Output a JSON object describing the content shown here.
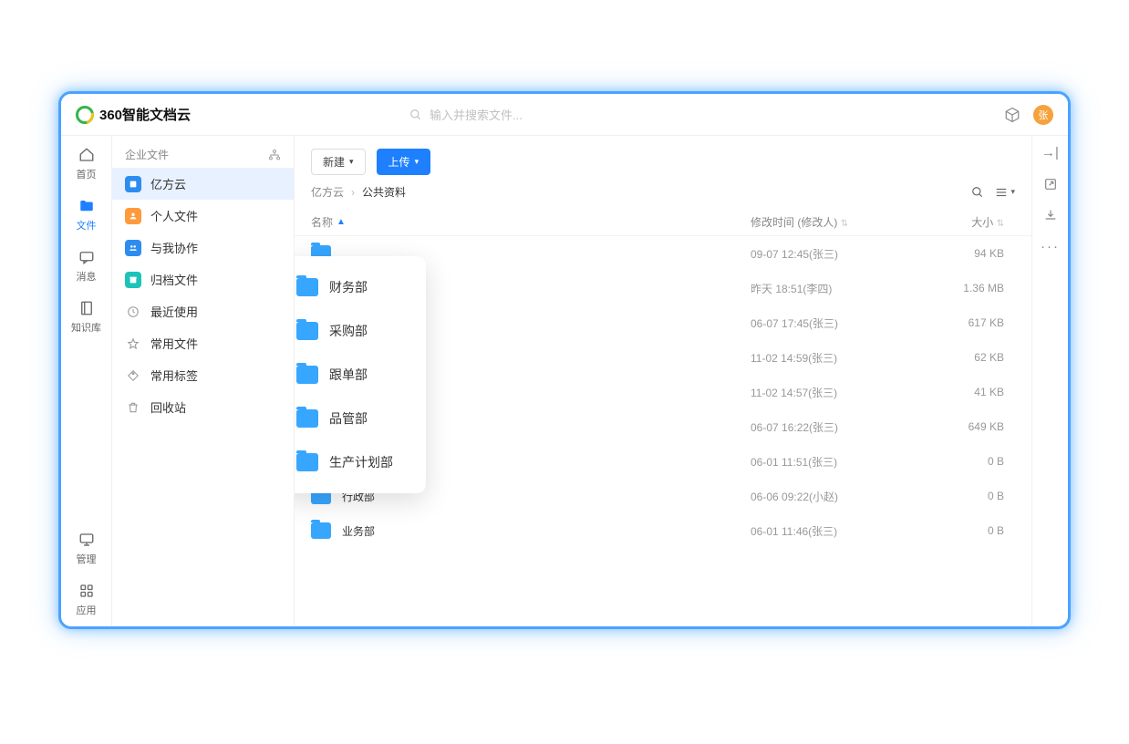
{
  "header": {
    "logo_text": "360智能文档云",
    "search_placeholder": "输入并搜索文件...",
    "avatar_initial": "张"
  },
  "nav": [
    {
      "id": "home",
      "label": "首页",
      "icon": "home"
    },
    {
      "id": "files",
      "label": "文件",
      "icon": "folder",
      "active": true
    },
    {
      "id": "messages",
      "label": "消息",
      "icon": "chat"
    },
    {
      "id": "knowledge",
      "label": "知识库",
      "icon": "book"
    }
  ],
  "nav_bottom": [
    {
      "id": "manage",
      "label": "管理",
      "icon": "monitor"
    },
    {
      "id": "apps",
      "label": "应用",
      "icon": "grid"
    }
  ],
  "tree": {
    "header": "企业文件",
    "items": [
      {
        "label": "亿方云",
        "icon": "org",
        "color": "blue",
        "selected": true
      },
      {
        "label": "个人文件",
        "icon": "person",
        "color": "orange"
      },
      {
        "label": "与我协作",
        "icon": "collab",
        "color": "blue"
      },
      {
        "label": "归档文件",
        "icon": "archive",
        "color": "teal"
      },
      {
        "label": "最近使用",
        "icon": "clock",
        "color": "grey"
      },
      {
        "label": "常用文件",
        "icon": "star",
        "color": "grey"
      },
      {
        "label": "常用标签",
        "icon": "tag",
        "color": "grey"
      },
      {
        "label": "回收站",
        "icon": "trash",
        "color": "grey"
      }
    ]
  },
  "toolbar": {
    "new_label": "新建",
    "upload_label": "上传"
  },
  "breadcrumbs": [
    "亿方云",
    "公共资料"
  ],
  "columns": {
    "name": "名称",
    "time": "修改时间 (修改人)",
    "size": "大小"
  },
  "rows": [
    {
      "name": "",
      "time": "09-07 12:45(张三)",
      "size": "94 KB"
    },
    {
      "name": "",
      "time": "昨天 18:51(李四)",
      "size": "1.36 MB"
    },
    {
      "name": "",
      "time": "06-07 17:45(张三)",
      "size": "617 KB"
    },
    {
      "name": "",
      "time": "11-02 14:59(张三)",
      "size": "62 KB"
    },
    {
      "name": "",
      "time": "11-02 14:57(张三)",
      "size": "41 KB"
    },
    {
      "name": "",
      "time": "06-07 16:22(张三)",
      "size": "649 KB"
    },
    {
      "name": "",
      "time": "06-01 11:51(张三)",
      "size": "0 B"
    },
    {
      "name": "行政部",
      "time": "06-06 09:22(小赵)",
      "size": "0 B"
    },
    {
      "name": "业务部",
      "time": "06-01 11:46(张三)",
      "size": "0 B"
    }
  ],
  "popup": [
    "财务部",
    "采购部",
    "跟单部",
    "品管部",
    "生产计划部"
  ]
}
